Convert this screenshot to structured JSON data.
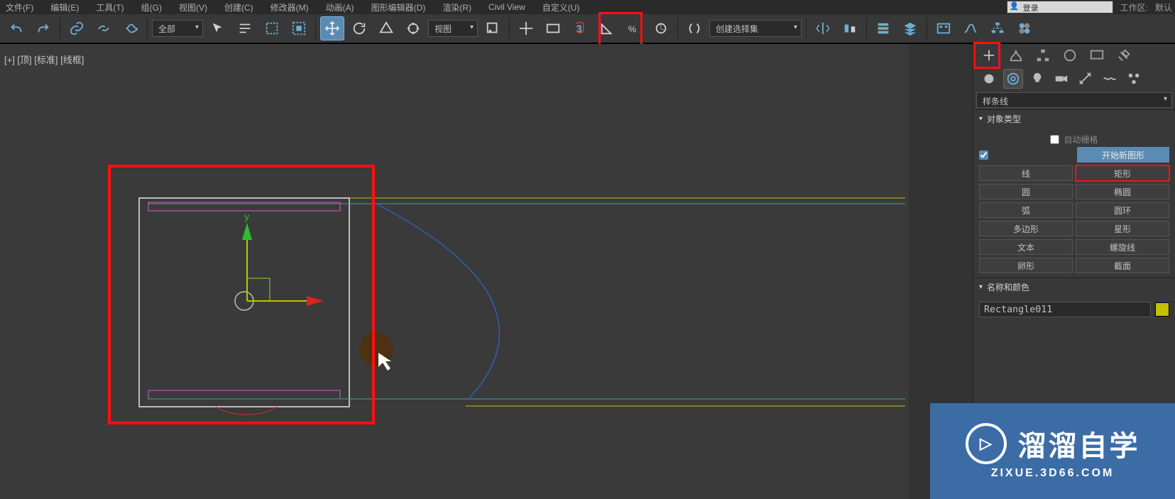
{
  "menubar": {
    "items": [
      "文件(F)",
      "编辑(E)",
      "工具(T)",
      "组(G)",
      "视图(V)",
      "创建(C)",
      "修改器(M)",
      "动画(A)",
      "图形编辑器(D)",
      "渲染(R)",
      "Civil View",
      "自定义(U)"
    ],
    "login": "登录",
    "workspace_label": "工作区:",
    "workspace_value": "默认"
  },
  "toolbar": {
    "filter": "全部",
    "view_mode": "视图",
    "selection_set": "创建选择集"
  },
  "viewport": {
    "label": "[+] [顶] [标准] [线框]",
    "axis_y": "y"
  },
  "panel": {
    "category": "样条线",
    "rollouts": {
      "object_type": {
        "title": "对象类型",
        "auto_grid": "自动栅格",
        "start_new_shape": "开始新图形",
        "buttons": [
          "线",
          "矩形",
          "圆",
          "椭圆",
          "弧",
          "圆环",
          "多边形",
          "星形",
          "文本",
          "螺旋线",
          "卵形",
          "截面"
        ]
      },
      "name_color": {
        "title": "名称和颜色",
        "object_name": "Rectangle011"
      }
    }
  },
  "brand": {
    "title": "溜溜自学",
    "subtitle": "ZIXUE.3D66.COM",
    "logo_glyph": "▷"
  }
}
